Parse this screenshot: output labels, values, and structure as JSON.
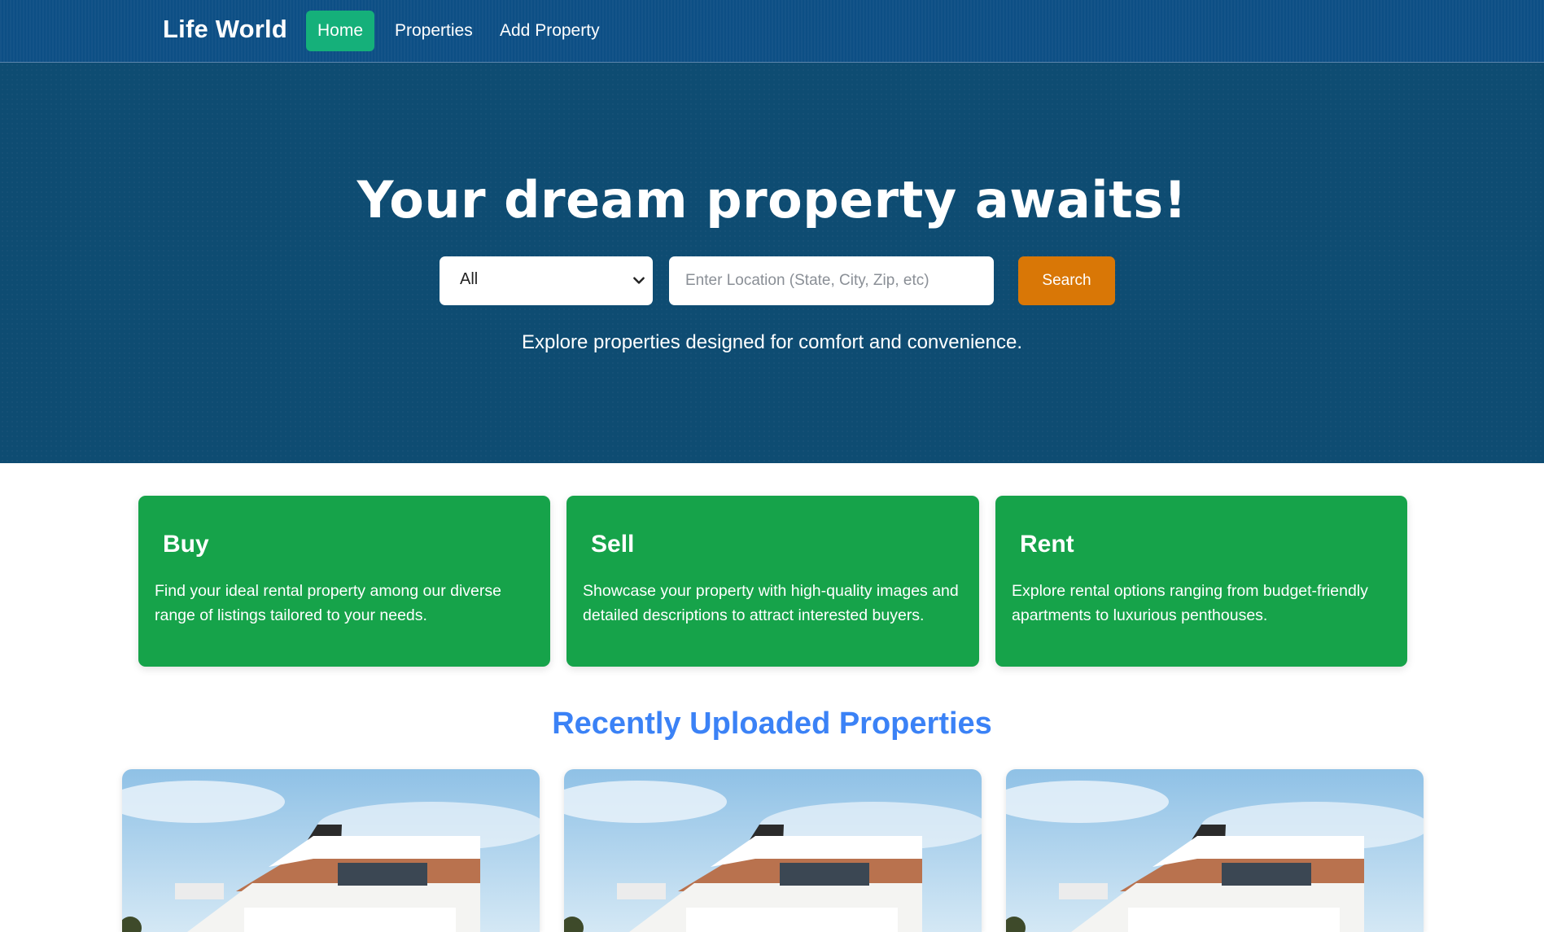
{
  "navbar": {
    "brand": "Life World",
    "links": [
      {
        "label": "Home",
        "active": true
      },
      {
        "label": "Properties",
        "active": false
      },
      {
        "label": "Add Property",
        "active": false
      }
    ]
  },
  "hero": {
    "title": "Your dream property awaits!",
    "type_select": {
      "selected": "All"
    },
    "location_input": {
      "value": "",
      "placeholder": "Enter Location (State, City, Zip, etc)"
    },
    "search_label": "Search",
    "subtitle": "Explore properties designed for comfort and convenience."
  },
  "features": [
    {
      "title": "Buy",
      "description": "Find your ideal rental property among our diverse range of listings tailored to your needs."
    },
    {
      "title": "Sell",
      "description": "Showcase your property with high-quality images and detailed descriptions to attract interested buyers."
    },
    {
      "title": "Rent",
      "description": "Explore rental options ranging from budget-friendly apartments to luxurious penthouses."
    }
  ],
  "recent": {
    "title": "Recently Uploaded Properties"
  },
  "colors": {
    "navbar_bg": "#0d4f85",
    "hero_bg": "#0e4c72",
    "active_nav": "#15b07a",
    "search_button": "#d97706",
    "feature_card": "#16a34a",
    "section_title": "#3b82f6"
  },
  "icons": {
    "select_caret": "chevron-down-icon"
  }
}
